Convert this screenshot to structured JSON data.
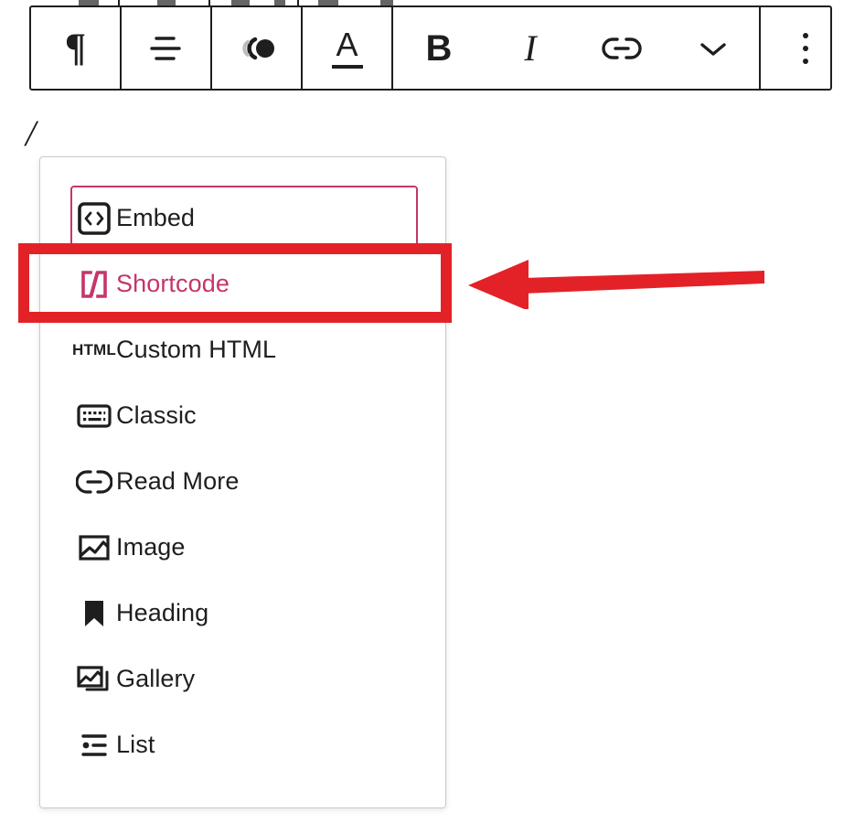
{
  "page": {
    "background": "#ffffff",
    "accent_pink": "#c5356b",
    "annotation_red": "#e32227",
    "text_color": "#1e1e1e",
    "panel_border": "#c9c9c9"
  },
  "editor": {
    "typed_text": "/"
  },
  "toolbar": {
    "name": "block-toolbar",
    "groups": [
      {
        "buttons": [
          {
            "name": "block-type-paragraph",
            "icon": "paragraph-icon",
            "glyph": "¶",
            "label": "Paragraph"
          }
        ]
      },
      {
        "buttons": [
          {
            "name": "align-text",
            "icon": "align-text-icon",
            "label": "Align text"
          }
        ]
      },
      {
        "buttons": [
          {
            "name": "move-block",
            "icon": "drag-handle-icon",
            "label": "Move"
          }
        ]
      },
      {
        "buttons": [
          {
            "name": "text-color",
            "icon": "text-color-icon",
            "glyph": "A",
            "label": "Text color"
          }
        ]
      },
      {
        "buttons": [
          {
            "name": "bold",
            "icon": "bold-icon",
            "glyph": "B",
            "label": "Bold"
          },
          {
            "name": "italic",
            "icon": "italic-icon",
            "glyph": "I",
            "label": "Italic"
          },
          {
            "name": "link",
            "icon": "link-icon",
            "label": "Link"
          },
          {
            "name": "more-formatting",
            "icon": "chevron-down-icon",
            "label": "More"
          }
        ]
      },
      {
        "buttons": [
          {
            "name": "block-options",
            "icon": "more-vertical-icon",
            "label": "Options"
          }
        ]
      }
    ]
  },
  "inserter": {
    "name": "block-inserter-menu",
    "items": [
      {
        "label": "Embed",
        "icon": "embed-code-icon",
        "state": "focused"
      },
      {
        "label": "Shortcode",
        "icon": "shortcode-icon",
        "state": "selected"
      },
      {
        "label": "Custom HTML",
        "icon": "html-badge-icon",
        "badge": "HTML",
        "state": "normal"
      },
      {
        "label": "Classic",
        "icon": "keyboard-icon",
        "state": "normal"
      },
      {
        "label": "Read More",
        "icon": "read-more-icon",
        "state": "normal"
      },
      {
        "label": "Image",
        "icon": "image-icon",
        "state": "normal"
      },
      {
        "label": "Heading",
        "icon": "heading-bookmark-icon",
        "state": "normal"
      },
      {
        "label": "Gallery",
        "icon": "gallery-icon",
        "state": "normal"
      },
      {
        "label": "List",
        "icon": "list-icon",
        "state": "normal"
      }
    ]
  },
  "annotation": {
    "highlight_box": {
      "name": "shortcode-highlight-rect",
      "target": "Shortcode"
    },
    "arrow": {
      "name": "pointer-arrow",
      "direction": "left",
      "target": "Shortcode"
    }
  }
}
